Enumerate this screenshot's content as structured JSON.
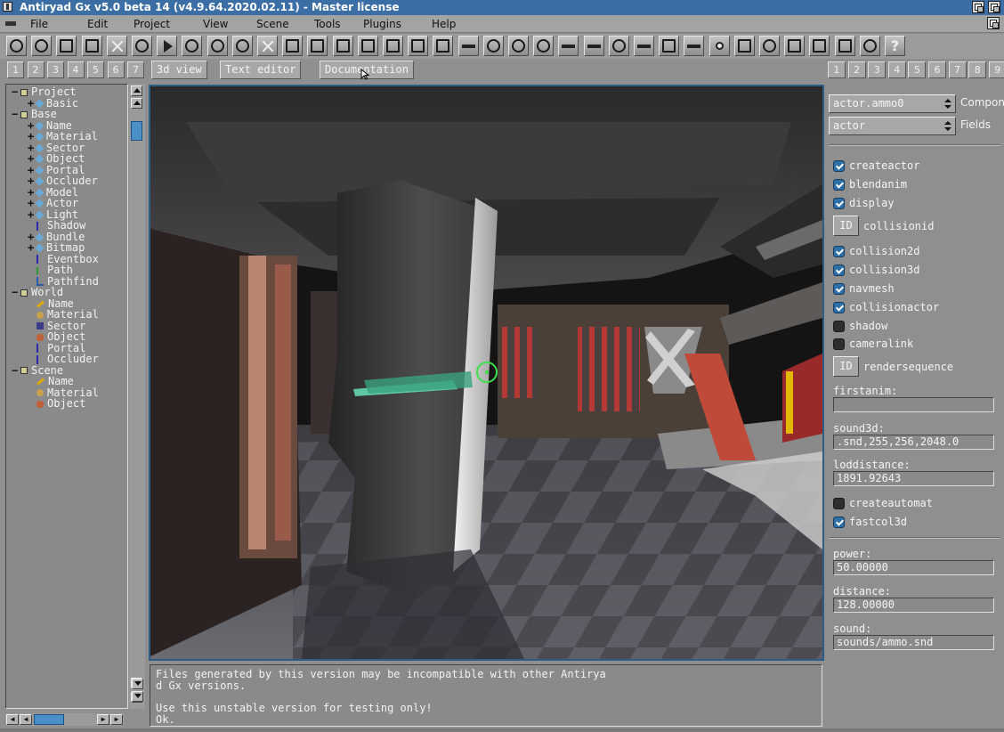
{
  "window": {
    "title": "Antiryad Gx v5.0 beta 14 (v4.9.64.2020.02.11) - Master license"
  },
  "menu": [
    "File",
    "Edit",
    "Project",
    "View",
    "Scene",
    "Tools",
    "Plugins",
    "Help"
  ],
  "toolbar_icons": [
    "power-icon",
    "info-icon",
    "save-icon",
    "save-as-icon",
    "close-icon",
    "move-icon",
    "play-icon",
    "gear-icon",
    "gear-icon",
    "gear-icon",
    "tools-icon",
    "grid-icon",
    "slash-icon",
    "monitor-icon",
    "terminal-icon",
    "page-icon",
    "edit-icon",
    "text-a-icon",
    "key-icon",
    "timer-icon",
    "target-icon",
    "palette-icon",
    "list-icon",
    "list-icon",
    "eye-icon",
    "brush-icon",
    "camera-icon",
    "gun-icon",
    "record-icon",
    "circuit-icon",
    "drop-icon",
    "hatch-icon",
    "dots-icon",
    "window-icon",
    "cursor-icon",
    "help-icon"
  ],
  "left_tabs": [
    "1",
    "2",
    "3",
    "4",
    "5",
    "6",
    "7"
  ],
  "center_tabs": [
    "3d view",
    "Text editor",
    "Documentation"
  ],
  "right_tabs": [
    "1",
    "2",
    "3",
    "4",
    "5",
    "6",
    "7",
    "8",
    "9"
  ],
  "tree": [
    {
      "level": 0,
      "expander": "−",
      "icon": "folder",
      "label": "Project"
    },
    {
      "level": 1,
      "expander": "+",
      "icon": "gem",
      "label": "Basic"
    },
    {
      "level": 0,
      "expander": "−",
      "icon": "folder",
      "label": "Base"
    },
    {
      "level": 1,
      "expander": "+",
      "icon": "gem",
      "label": "Name"
    },
    {
      "level": 1,
      "expander": "+",
      "icon": "gem",
      "label": "Material"
    },
    {
      "level": 1,
      "expander": "+",
      "icon": "gem",
      "label": "Sector"
    },
    {
      "level": 1,
      "expander": "+",
      "icon": "gem",
      "label": "Object"
    },
    {
      "level": 1,
      "expander": "+",
      "icon": "gem",
      "label": "Portal"
    },
    {
      "level": 1,
      "expander": "+",
      "icon": "gem",
      "label": "Occluder"
    },
    {
      "level": 1,
      "expander": "+",
      "icon": "gem",
      "label": "Model"
    },
    {
      "level": 1,
      "expander": "+",
      "icon": "gem",
      "label": "Actor"
    },
    {
      "level": 1,
      "expander": "+",
      "icon": "gem",
      "label": "Light"
    },
    {
      "level": 1,
      "expander": "",
      "icon": "line",
      "label": "Shadow"
    },
    {
      "level": 1,
      "expander": "+",
      "icon": "gem",
      "label": "Bundle"
    },
    {
      "level": 1,
      "expander": "+",
      "icon": "gem",
      "label": "Bitmap"
    },
    {
      "level": 1,
      "expander": "",
      "icon": "line",
      "label": "Eventbox"
    },
    {
      "level": 1,
      "expander": "",
      "icon": "path",
      "label": "Path"
    },
    {
      "level": 1,
      "expander": "",
      "icon": "path2",
      "label": "Pathfind"
    },
    {
      "level": 0,
      "expander": "−",
      "icon": "folder",
      "label": "World"
    },
    {
      "level": 1,
      "expander": "",
      "icon": "pen",
      "label": "Name"
    },
    {
      "level": 1,
      "expander": "",
      "icon": "mat",
      "label": "Material"
    },
    {
      "level": 1,
      "expander": "",
      "icon": "sect",
      "label": "Sector"
    },
    {
      "level": 1,
      "expander": "",
      "icon": "obj",
      "label": "Object"
    },
    {
      "level": 1,
      "expander": "",
      "icon": "line",
      "label": "Portal"
    },
    {
      "level": 1,
      "expander": "",
      "icon": "line",
      "label": "Occluder"
    },
    {
      "level": 0,
      "expander": "−",
      "icon": "folder",
      "label": "Scene"
    },
    {
      "level": 1,
      "expander": "",
      "icon": "pen",
      "label": "Name"
    },
    {
      "level": 1,
      "expander": "",
      "icon": "mat",
      "label": "Material"
    },
    {
      "level": 1,
      "expander": "",
      "icon": "obj",
      "label": "Object"
    }
  ],
  "console": {
    "lines": [
      "Files generated by this version may be incompatible with other Antirya",
      "d Gx versions.",
      "",
      "Use this unstable version for testing only!",
      "Ok."
    ]
  },
  "panel": {
    "component_value": "actor.ammo0",
    "component_label": "Compon",
    "fields_value": "actor",
    "fields_label": "Fields",
    "checks1": [
      {
        "label": "createactor",
        "checked": true
      },
      {
        "label": "blendanim",
        "checked": true
      },
      {
        "label": "display",
        "checked": true
      }
    ],
    "id_label": "ID",
    "collisionid": "collisionid",
    "checks2": [
      {
        "label": "collision2d",
        "checked": true
      },
      {
        "label": "collision3d",
        "checked": true
      },
      {
        "label": "navmesh",
        "checked": true
      },
      {
        "label": "collisionactor",
        "checked": true
      },
      {
        "label": "shadow",
        "checked": false
      },
      {
        "label": "cameralink",
        "checked": false
      }
    ],
    "rendersequence": "rendersequence",
    "firstanim_label": "firstanim:",
    "firstanim_value": "",
    "sound3d_label": "sound3d:",
    "sound3d_value": ".snd,255,256,2048.0",
    "loddistance_label": "loddistance:",
    "loddistance_value": "1891.92643",
    "checks3": [
      {
        "label": "createautomat",
        "checked": false
      },
      {
        "label": "fastcol3d",
        "checked": true
      }
    ],
    "power_label": "power:",
    "power_value": "50.00000",
    "distance_label": "distance:",
    "distance_value": "128.00000",
    "sound_label": "sound:",
    "sound_value": "sounds/ammo.snd"
  }
}
